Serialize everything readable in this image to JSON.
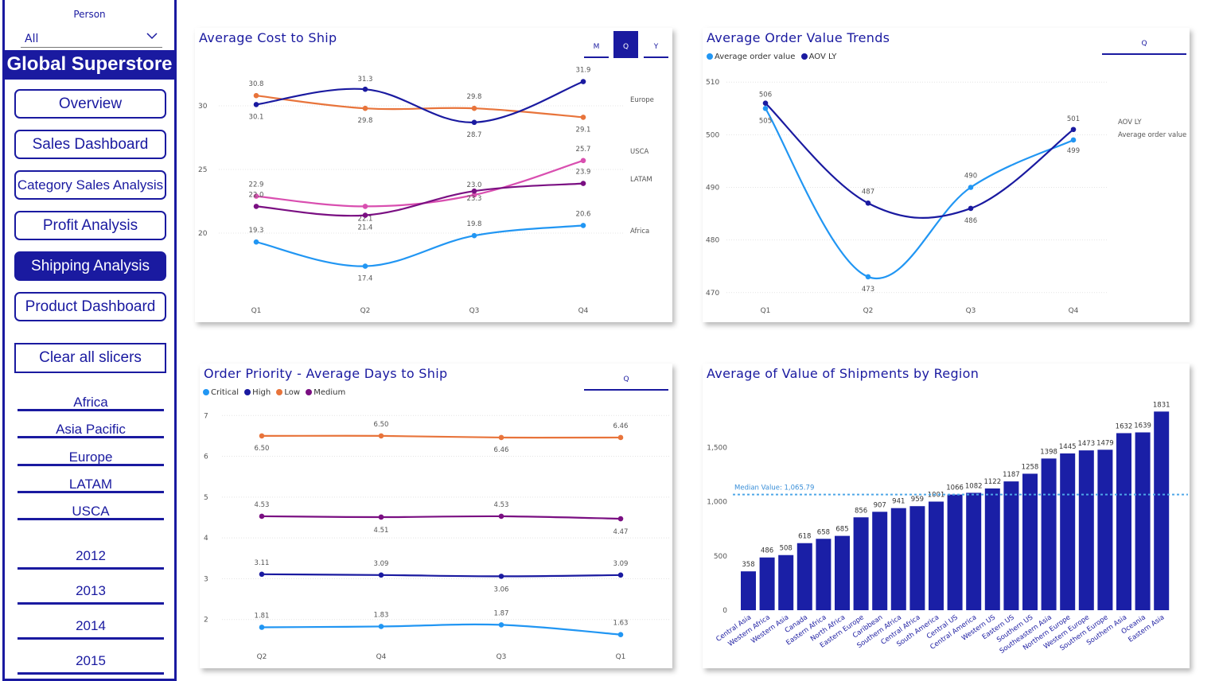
{
  "sidebar": {
    "person_label": "Person",
    "person_value": "All",
    "brand": "Global Superstore",
    "nav": [
      {
        "label": "Overview",
        "active": false
      },
      {
        "label": "Sales Dashboard",
        "active": false
      },
      {
        "label": "Category Sales Analysis",
        "active": false
      },
      {
        "label": "Profit Analysis",
        "active": false
      },
      {
        "label": "Shipping Analysis",
        "active": true
      },
      {
        "label": "Product Dashboard",
        "active": false
      }
    ],
    "clear_label": "Clear all slicers",
    "regions": [
      "Africa",
      "Asia Pacific",
      "Europe",
      "LATAM",
      "USCA"
    ],
    "years": [
      "2012",
      "2013",
      "2014",
      "2015"
    ]
  },
  "colors": {
    "navy": "#1a1aa0",
    "blue": "#2196f3",
    "orange": "#e8743b",
    "pink": "#d94fb0",
    "purple": "#7a0f82",
    "bar": "#1a1fa6"
  },
  "cost_to_ship": {
    "title": "Average Cost to Ship",
    "tabs": [
      {
        "label": "M",
        "active": false
      },
      {
        "label": "Q",
        "active": true
      },
      {
        "label": "Y",
        "active": false
      }
    ],
    "chart_data": {
      "type": "line",
      "categories": [
        "Q1",
        "Q2",
        "Q3",
        "Q4"
      ],
      "ylim": [
        15.5,
        33
      ],
      "yticks": [
        20,
        25,
        30
      ],
      "series": [
        {
          "name": "Europe",
          "values": [
            30.8,
            29.8,
            29.8,
            29.1
          ],
          "labels": [
            "30.8",
            "29.8",
            "29.8",
            "29.1"
          ],
          "color": "#e8743b"
        },
        {
          "name": "",
          "values": [
            30.1,
            31.3,
            28.7,
            31.9
          ],
          "labels": [
            "30.1",
            "31.3",
            "28.7",
            "31.9"
          ],
          "color": "#1a1aa0"
        },
        {
          "name": "USCA",
          "values": [
            22.9,
            22.1,
            23.0,
            25.7
          ],
          "labels": [
            "22.9",
            "22.1",
            "23.0",
            "25.7"
          ],
          "color": "#d94fb0"
        },
        {
          "name": "LATAM",
          "values": [
            22.1,
            21.4,
            23.3,
            23.9
          ],
          "labels": [
            "22.0",
            "21.4",
            "23.3",
            "23.9"
          ],
          "color": "#7a0f82"
        },
        {
          "name": "Africa",
          "values": [
            19.3,
            17.4,
            19.8,
            20.6
          ],
          "labels": [
            "19.3",
            "17.4",
            "19.8",
            "20.6"
          ],
          "color": "#2196f3"
        }
      ]
    }
  },
  "aov": {
    "title": "Average Order Value Trends",
    "tab_label": "Q",
    "chart_data": {
      "type": "line",
      "categories": [
        "Q1",
        "Q2",
        "Q3",
        "Q4"
      ],
      "ylim": [
        468,
        512
      ],
      "yticks": [
        470,
        480,
        490,
        500,
        510
      ],
      "legend": [
        "Average order value",
        "AOV LY"
      ],
      "end_labels": [
        "AOV LY",
        "Average order value"
      ],
      "series": [
        {
          "name": "Average order value",
          "values": [
            505,
            473,
            490,
            499
          ],
          "labels": [
            "505",
            "473",
            "490",
            "499"
          ],
          "color": "#2196f3"
        },
        {
          "name": "AOV LY",
          "values": [
            506,
            487,
            486,
            501
          ],
          "labels": [
            "506",
            "487",
            "486",
            "501"
          ],
          "color": "#1a1aa0"
        }
      ]
    }
  },
  "priority": {
    "title": "Order Priority - Average Days to Ship",
    "tab_label": "Q",
    "chart_data": {
      "type": "line",
      "categories": [
        "Q2",
        "Q4",
        "Q3",
        "Q1"
      ],
      "ylim": [
        1.8,
        7.2
      ],
      "yticks": [
        2,
        3,
        4,
        5,
        6,
        7
      ],
      "legend": [
        "Critical",
        "High",
        "Low",
        "Medium"
      ],
      "series": [
        {
          "name": "Low",
          "values": [
            6.5,
            6.5,
            6.46,
            6.46
          ],
          "labels": [
            "6.50",
            "6.50",
            "6.46",
            "6.46"
          ],
          "color": "#e8743b"
        },
        {
          "name": "Medium",
          "values": [
            4.53,
            4.51,
            4.53,
            4.47
          ],
          "labels": [
            "4.53",
            "4.51",
            "4.53",
            "4.47"
          ],
          "color": "#7a0f82"
        },
        {
          "name": "High",
          "values": [
            3.11,
            3.09,
            3.06,
            3.09
          ],
          "labels": [
            "3.11",
            "3.09",
            "3.06",
            "3.09"
          ],
          "color": "#1a1aa0"
        },
        {
          "name": "Critical",
          "values": [
            1.81,
            1.83,
            1.87,
            1.63
          ],
          "labels": [
            "1.81",
            "1.83",
            "1.87",
            "1.63"
          ],
          "color": "#2196f3"
        }
      ]
    }
  },
  "shipments": {
    "title": "Average of Value of Shipments by Region",
    "chart_data": {
      "type": "bar",
      "categories": [
        "Central Asia",
        "Western Africa",
        "Western Asia",
        "Canada",
        "Eastern Africa",
        "North Africa",
        "Eastern Europe",
        "Caribbean",
        "Southern Africa",
        "Central Africa",
        "South America",
        "Central US",
        "Central America",
        "Western US",
        "Eastern US",
        "Southern US",
        "Southeastern Asia",
        "Northern Europe",
        "Western Europe",
        "Southern Europe",
        "Southern Asia",
        "Oceania",
        "Eastern Asia"
      ],
      "values": [
        358,
        486,
        508,
        618,
        658,
        685,
        856,
        907,
        941,
        959,
        1001,
        1066,
        1082,
        1122,
        1187,
        1258,
        1398,
        1445,
        1473,
        1479,
        1632,
        1639,
        1831
      ],
      "ylim": [
        0,
        1980
      ],
      "yticks": [
        0,
        500,
        1000,
        1500
      ],
      "ytick_labels": [
        "0",
        "500",
        "1,000",
        "1,500"
      ],
      "median": 1065.79,
      "median_label": "Median Value: 1,065.79"
    }
  }
}
